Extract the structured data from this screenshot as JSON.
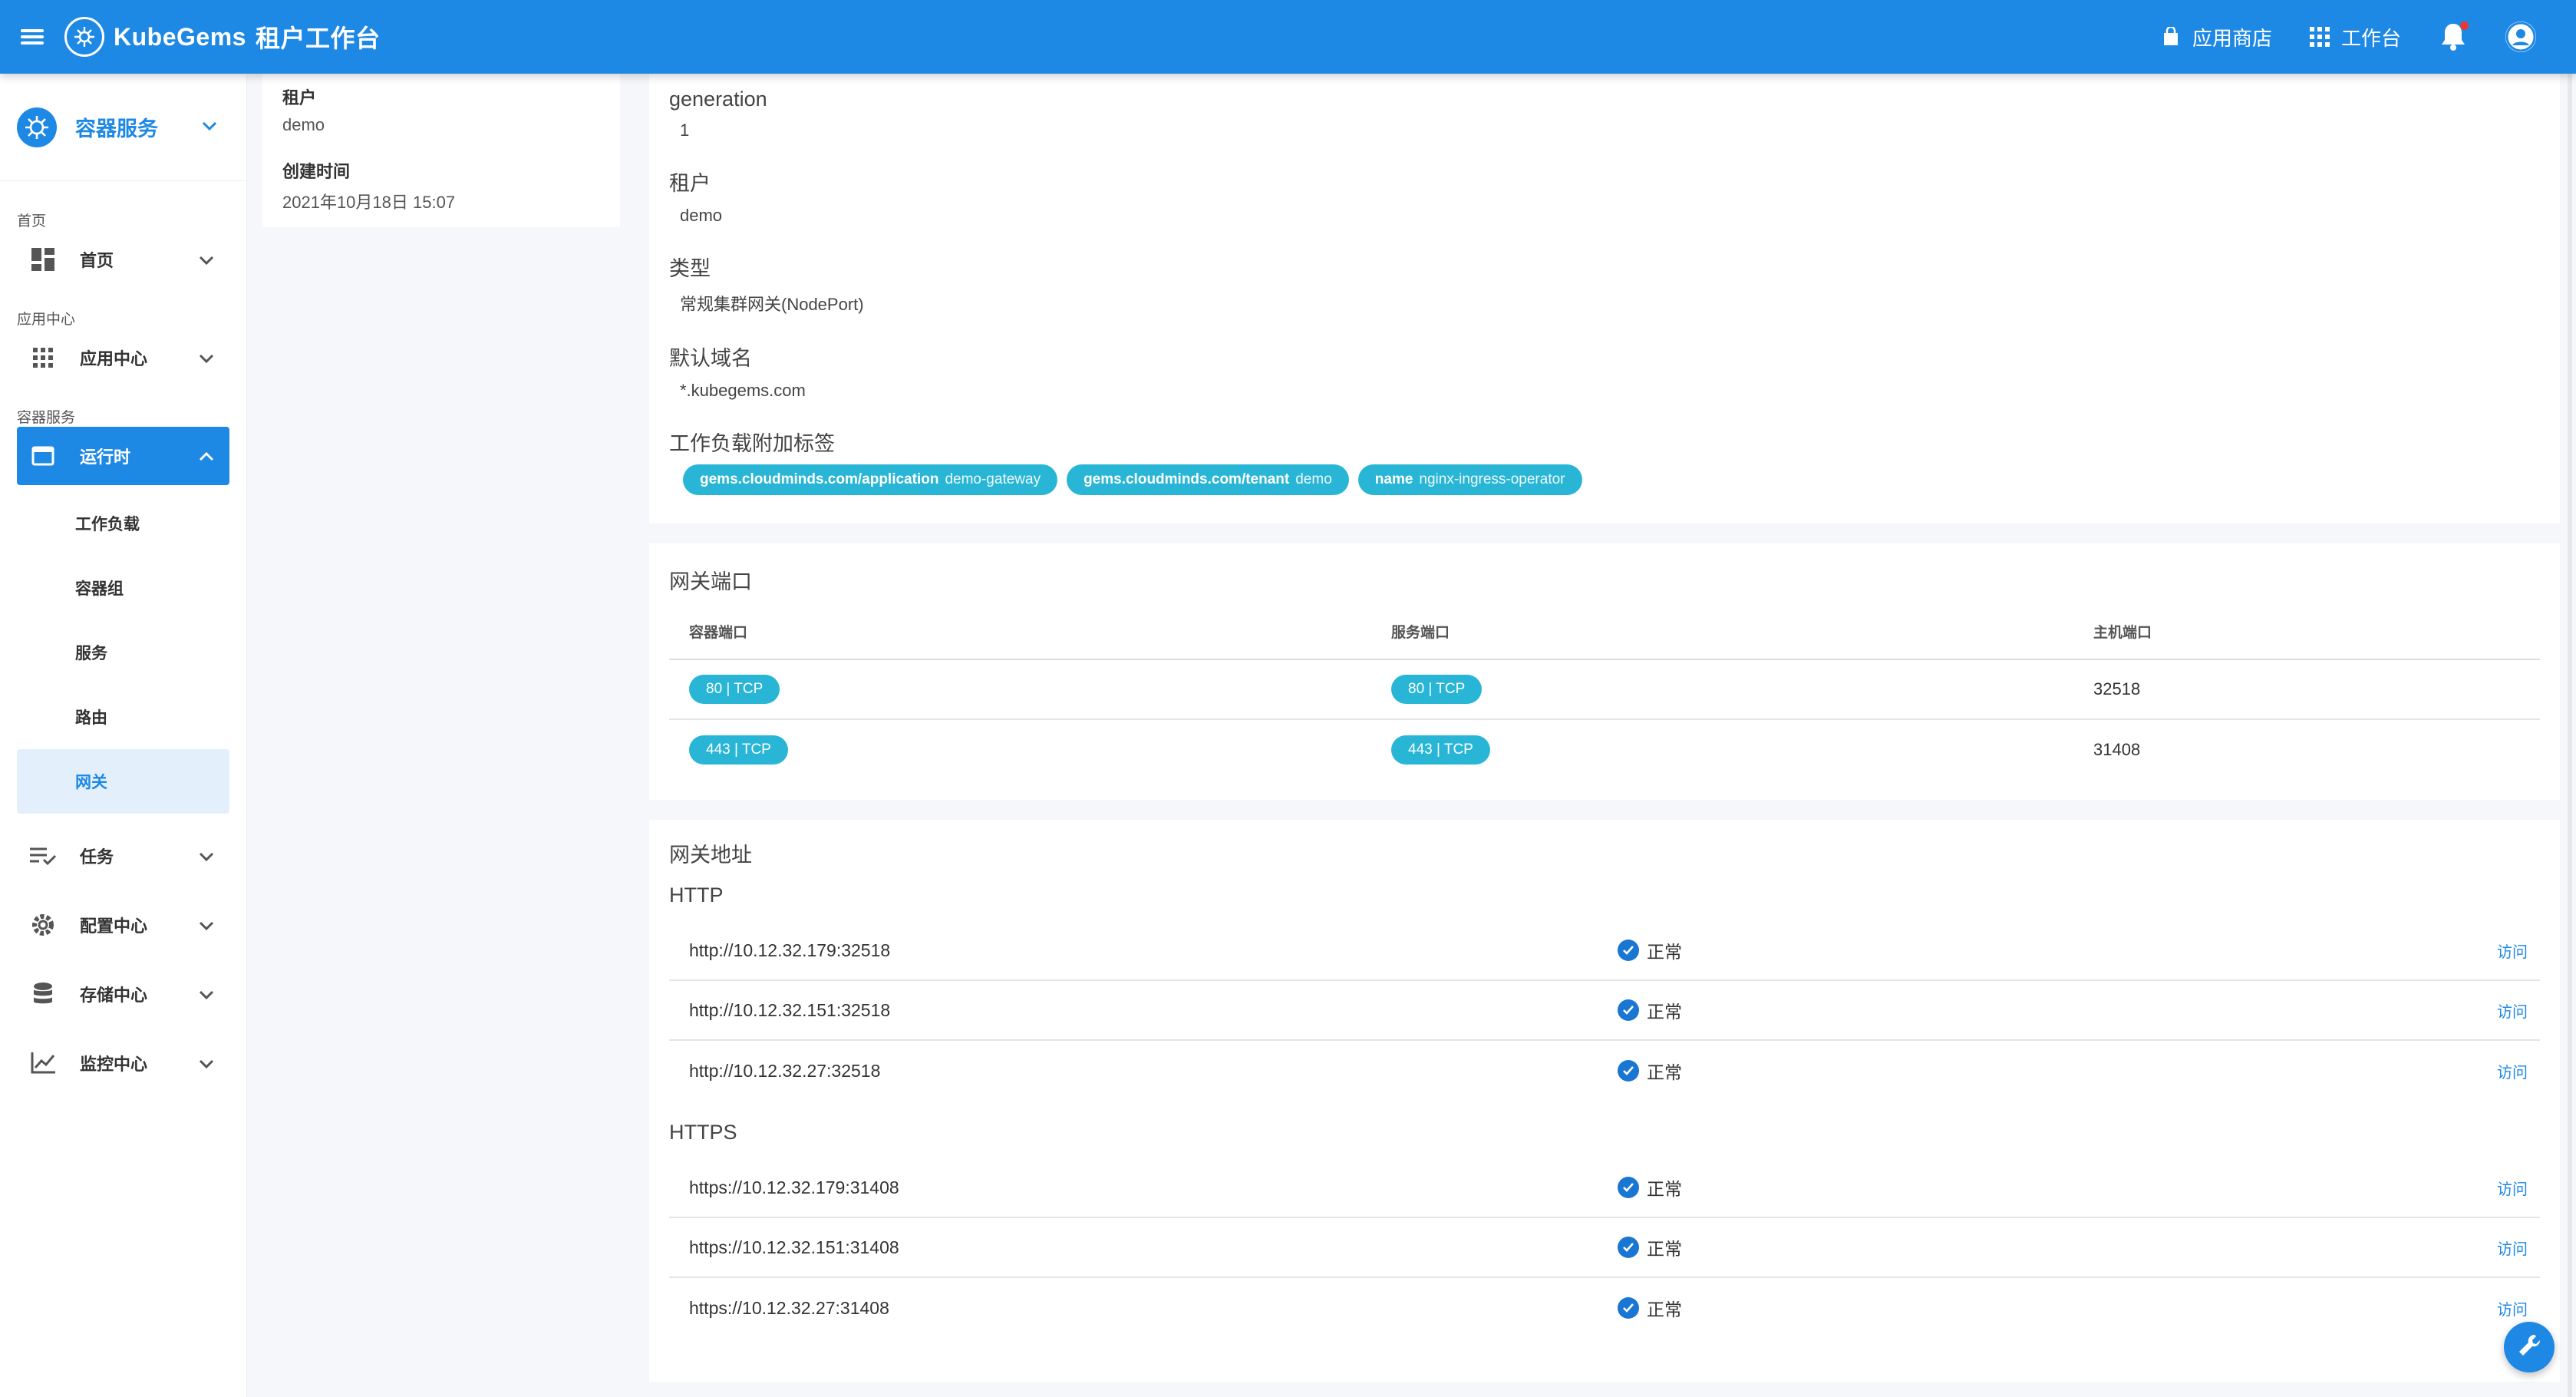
{
  "app": {
    "brand": "KubeGems",
    "title": "租户工作台"
  },
  "topbar": {
    "app_store": "应用商店",
    "workbench": "工作台"
  },
  "sidebar": {
    "header": "容器服务",
    "sections": {
      "home": "首页",
      "app_center": "应用中心",
      "container": "容器服务"
    },
    "items": {
      "home": "首页",
      "app_center": "应用中心",
      "runtime": "运行时",
      "task": "任务",
      "config": "配置中心",
      "storage": "存储中心",
      "monitor": "监控中心"
    },
    "runtime_sub": [
      "工作负载",
      "容器组",
      "服务",
      "路由",
      "网关"
    ]
  },
  "info": {
    "tenant_label": "租户",
    "tenant_value": "demo",
    "created_label": "创建时间",
    "created_value": "2021年10月18日 15:07"
  },
  "meta": {
    "generation_label": "generation",
    "generation_value": "1",
    "tenant_label": "租户",
    "tenant_value": "demo",
    "type_label": "类型",
    "type_value": "常规集群网关(NodePort)",
    "domain_label": "默认域名",
    "domain_value": "*.kubegems.com",
    "labels_label": "工作负载附加标签",
    "labels": [
      {
        "key": "gems.cloudminds.com/application",
        "value": "demo-gateway"
      },
      {
        "key": "gems.cloudminds.com/tenant",
        "value": "demo"
      },
      {
        "key": "name",
        "value": "nginx-ingress-operator"
      }
    ]
  },
  "ports": {
    "title": "网关端口",
    "headers": [
      "容器端口",
      "服务端口",
      "主机端口"
    ],
    "rows": [
      {
        "container": "80 | TCP",
        "service": "80 | TCP",
        "host": "32518"
      },
      {
        "container": "443 | TCP",
        "service": "443 | TCP",
        "host": "31408"
      }
    ]
  },
  "address": {
    "title": "网关地址",
    "http_title": "HTTP",
    "https_title": "HTTPS",
    "status_text": "正常",
    "visit_text": "访问",
    "http": [
      "http://10.12.32.179:32518",
      "http://10.12.32.151:32518",
      "http://10.12.32.27:32518"
    ],
    "https": [
      "https://10.12.32.179:31408",
      "https://10.12.32.151:31408",
      "https://10.12.32.27:31408"
    ]
  },
  "colors": {
    "primary": "#1e88e5",
    "chip": "#29b6d6"
  }
}
